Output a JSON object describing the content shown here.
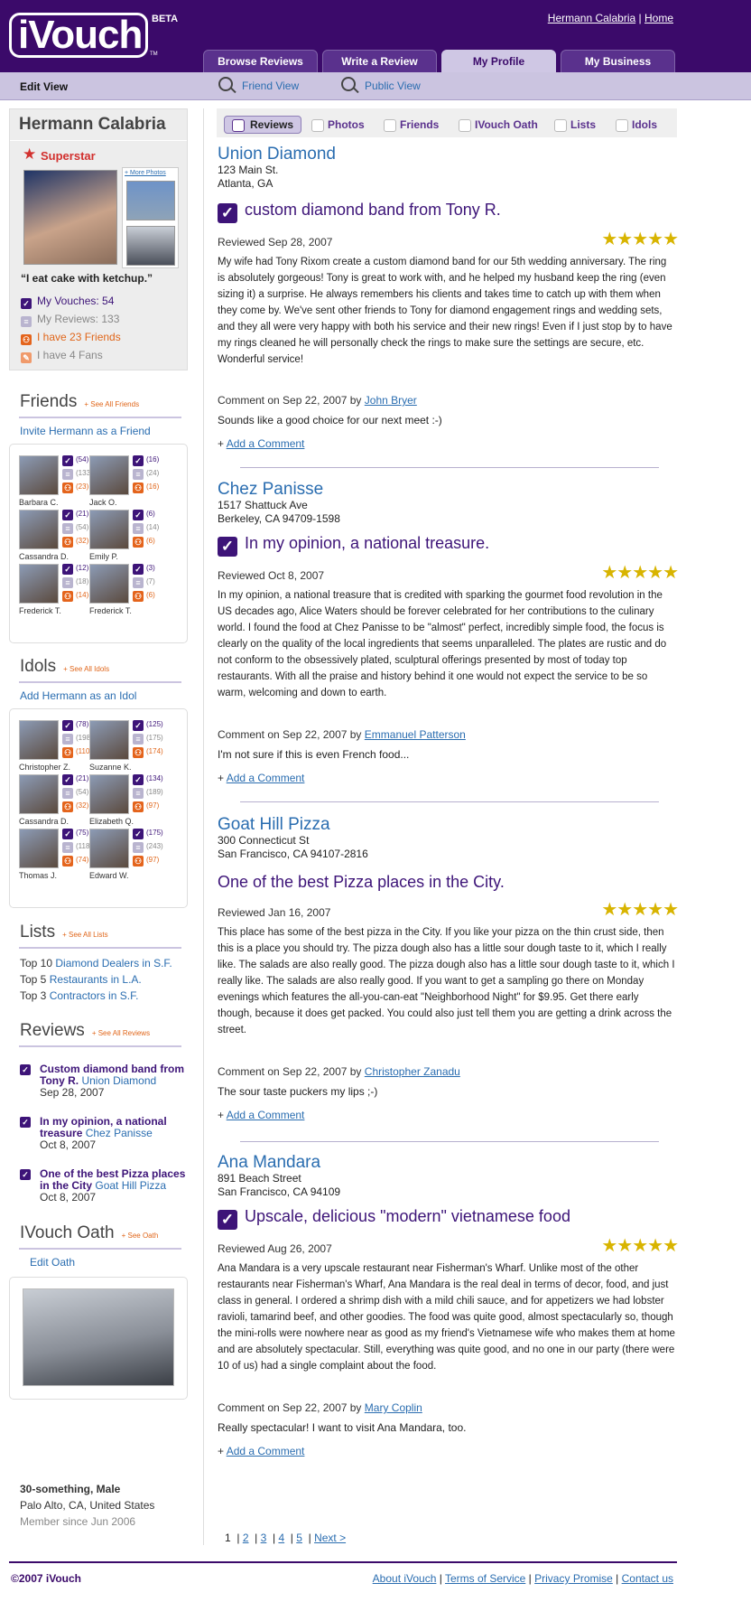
{
  "header": {
    "logo_text": "iVouch",
    "beta": "BETA",
    "tm": "TM",
    "user_link": "Hermann Calabria",
    "sep": "|",
    "home_link": "Home",
    "tabs": [
      "Browse Reviews",
      "Write a Review",
      "My Profile",
      "My Business"
    ],
    "active_tab": "My Profile"
  },
  "subnav": {
    "edit_view": "Edit View",
    "friend_view": "Friend View",
    "public_view": "Public View"
  },
  "profile": {
    "name": "Hermann Calabria",
    "badge": "Superstar",
    "more_photos": "+ More Photos",
    "quote": "“I eat cake with ketchup.”",
    "stats": [
      {
        "icon": "vouch-icon",
        "text": "My Vouches: 54",
        "color": "#3d1478"
      },
      {
        "icon": "reviews-icon",
        "text": "My Reviews: 133",
        "color": "#888888"
      },
      {
        "icon": "friends-icon",
        "text": "I have 23 Friends",
        "color": "#e0661a"
      },
      {
        "icon": "fans-icon",
        "text": "I have 4 Fans",
        "color": "#888888"
      }
    ]
  },
  "friends": {
    "heading": "Friends",
    "see_all": "See All Friends",
    "invite": "Invite Hermann as a Friend",
    "people": [
      {
        "name": "Barbara C.",
        "v": "(54)",
        "r": "(133)",
        "f": "(23)"
      },
      {
        "name": "Jack O.",
        "v": "(16)",
        "r": "(24)",
        "f": "(16)"
      },
      {
        "name": "Cassandra D.",
        "v": "(21)",
        "r": "(54)",
        "f": "(32)"
      },
      {
        "name": "Emily P.",
        "v": "(6)",
        "r": "(14)",
        "f": "(6)"
      },
      {
        "name": "Frederick T.",
        "v": "(12)",
        "r": "(18)",
        "f": "(14)"
      },
      {
        "name": "Frederick T.",
        "v": "(3)",
        "r": "(7)",
        "f": "(6)"
      }
    ]
  },
  "idols": {
    "heading": "Idols",
    "see_all": "See All Idols",
    "add": "Add Hermann as an Idol",
    "people": [
      {
        "name": "Christopher Z.",
        "v": "(78)",
        "r": "(198)",
        "f": "(110)"
      },
      {
        "name": "Suzanne K.",
        "v": "(125)",
        "r": "(175)",
        "f": "(174)"
      },
      {
        "name": "Cassandra D.",
        "v": "(21)",
        "r": "(54)",
        "f": "(32)"
      },
      {
        "name": "Elizabeth Q.",
        "v": "(134)",
        "r": "(189)",
        "f": "(97)"
      },
      {
        "name": "Thomas J.",
        "v": "(75)",
        "r": "(118)",
        "f": "(74)"
      },
      {
        "name": "Edward W.",
        "v": "(175)",
        "r": "(243)",
        "f": "(97)"
      }
    ]
  },
  "lists": {
    "heading": "Lists",
    "see_all": "See All Lists",
    "items": [
      {
        "prefix": "Top 10",
        "link": "Diamond Dealers in S.F."
      },
      {
        "prefix": "Top 5",
        "link": "Restaurants in L.A."
      },
      {
        "prefix": "Top 3",
        "link": "Contractors in S.F."
      }
    ]
  },
  "side_reviews": {
    "heading": "Reviews",
    "see_all": "See All Reviews",
    "items": [
      {
        "title": "Custom diamond band from Tony R.",
        "biz": "Union Diamond",
        "date": "Sep 28, 2007"
      },
      {
        "title": "In my opinion, a national treasure",
        "biz": "Chez Panisse",
        "date": "Oct 8, 2007"
      },
      {
        "title": "One of the best Pizza places in the City",
        "biz": "Goat Hill Pizza",
        "date": "Oct 8, 2007"
      }
    ]
  },
  "oath": {
    "heading": "IVouch Oath",
    "see": "See Oath",
    "edit": "Edit Oath"
  },
  "bio": {
    "line1": "30-something, Male",
    "line2": "Palo Alto, CA, United States",
    "line3": "Member since Jun 2006"
  },
  "review_tabs": [
    "Reviews",
    "Photos",
    "Friends",
    "IVouch Oath",
    "Lists",
    "Idols"
  ],
  "reviews": [
    {
      "biz": "Union Diamond",
      "addr1": "123 Main St.",
      "addr2": "Atlanta, GA",
      "title": "custom diamond band from Tony R.",
      "vouched": true,
      "date": "Reviewed Sep 28, 2007",
      "stars": 5,
      "body": "My wife had Tony Rixom create a custom diamond band for our 5th wedding anniversary. The ring is absolutely gorgeous! Tony is great to work with, and he helped my husband keep the ring (even sizing it) a surprise. He always remembers his clients and takes time to catch up with them when they come by. We've sent other friends to Tony for diamond engagement rings and wedding sets, and they all were very happy with both his service and their new rings! Even if I just stop by to have my rings cleaned he will personally check the rings to make sure the settings are secure, etc. Wonderful service!",
      "comment_meta": "Comment on Sep 22, 2007 by",
      "comment_author": "John Bryer",
      "comment": "Sounds like a good choice for our next meet :-)",
      "add_comment": "Add a Comment"
    },
    {
      "biz": "Chez Panisse",
      "addr1": "1517 Shattuck Ave",
      "addr2": "Berkeley, CA 94709-1598",
      "title": "In my opinion, a national treasure.",
      "vouched": true,
      "date": "Reviewed Oct 8, 2007",
      "stars": 5,
      "body": "In my opinion, a national treasure that is credited with sparking the gourmet food revolution in the US decades ago, Alice Waters should be forever celebrated for her contributions to the culinary world. I found the food at Chez Panisse to be \"almost\" perfect, incredibly simple food, the focus is clearly on the quality of the local ingredients that seems unparalleled. The plates are rustic and do not conform to the obsessively plated, sculptural offerings presented by most of today top restaurants. With all the praise and history behind it one would not expect the service to be so warm, welcoming and down to earth.",
      "comment_meta": "Comment on Sep 22, 2007 by",
      "comment_author": "Emmanuel Patterson",
      "comment": "I'm not sure if this is even French food...",
      "add_comment": "Add a Comment"
    },
    {
      "biz": "Goat Hill Pizza",
      "addr1": "300 Connecticut St",
      "addr2": "San Francisco, CA 94107-2816",
      "title": "One of the best Pizza places in the City.",
      "vouched": false,
      "date": "Reviewed Jan 16, 2007",
      "stars": 5,
      "body": "This place has some of the best pizza in the City. If you like your pizza on the thin crust side, then this is a place you should try. The pizza dough also has a little sour dough taste to it, which I really like. The salads are also really good. The pizza dough also has a little sour dough taste to it, which I really like. The salads are also really good. If you want to get a sampling go there on Monday evenings which features the all-you-can-eat \"Neighborhood Night\" for $9.95. Get there early though, because it does get packed. You could also just tell them you are getting a drink across the street.",
      "comment_meta": "Comment on Sep 22, 2007 by",
      "comment_author": "Christopher Zanadu",
      "comment": "The sour taste puckers my lips ;-)",
      "add_comment": "Add a Comment"
    },
    {
      "biz": "Ana Mandara",
      "addr1": "891 Beach Street",
      "addr2": "San Francisco, CA 94109",
      "title": "Upscale, delicious \"modern\" vietnamese food",
      "vouched": true,
      "date": "Reviewed Aug 26, 2007",
      "stars": 5,
      "body": "Ana Mandara is a very upscale restaurant near Fisherman's Wharf. Unlike most of the other restaurants near Fisherman's Wharf, Ana Mandara is the real deal in terms of decor, food, and just class in general. I ordered a shrimp dish with a mild chili sauce, and for appetizers we had lobster ravioli, tamarind beef, and other goodies. The food was quite good, almost spectacularly so, though the mini-rolls were nowhere near as good as my friend's Vietnamese wife who makes them at home and are absolutely spectacular. Still, everything was quite good, and no one in our party (there were 10 of us) had a single complaint about the food.",
      "comment_meta": "Comment on Sep 22, 2007 by",
      "comment_author": "Mary Coplin",
      "comment": "Really spectacular! I want to visit Ana Mandara, too.",
      "add_comment": "Add a Comment"
    }
  ],
  "pager": {
    "current": "1",
    "pages": [
      "2",
      "3",
      "4",
      "5"
    ],
    "next": "Next >"
  },
  "footer": {
    "copyright": "©2007 iVouch",
    "links": [
      "About iVouch",
      "Terms of Service",
      "Privacy Promise",
      "Contact us"
    ]
  },
  "colors": {
    "brand": "#3b0a6a",
    "accent_orange": "#e0661a",
    "link": "#2a6db0",
    "star": "#d8b400"
  }
}
